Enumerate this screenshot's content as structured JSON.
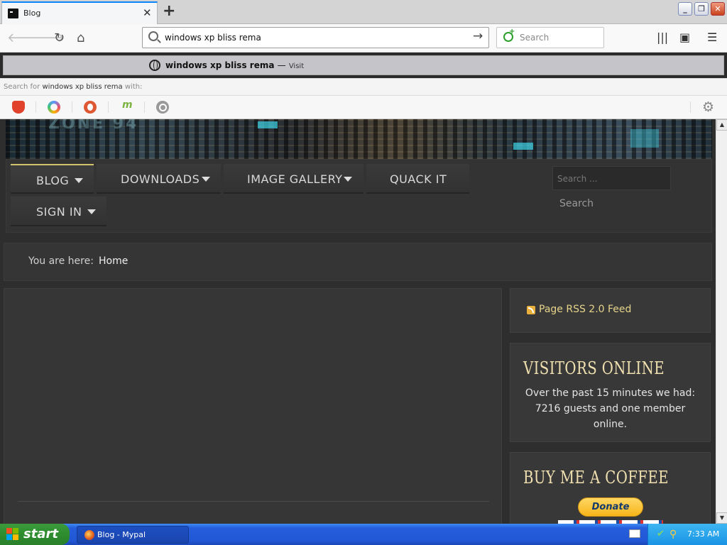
{
  "browser": {
    "tab": {
      "title": "Blog"
    },
    "url_value": "windows xp bliss rema",
    "search_placeholder": "Search",
    "suggestion": {
      "text": "windows xp bliss rema",
      "dash": "—",
      "action": "Visit"
    },
    "search_with": {
      "prefix": "Search for",
      "query": "windows xp bliss rema",
      "suffix": "with:"
    },
    "engines": [
      "brave-icon",
      "qwant-icon",
      "duckduckgo-icon",
      "mojeek-icon",
      "search-icon"
    ]
  },
  "site": {
    "banner_logo": "ZONE 94",
    "menu": {
      "items": [
        {
          "label": "BLOG",
          "has_dropdown": true,
          "active": true
        },
        {
          "label": "DOWNLOADS",
          "has_dropdown": true,
          "active": false
        },
        {
          "label": "IMAGE GALLERY",
          "has_dropdown": true,
          "active": false
        },
        {
          "label": "QUACK IT",
          "has_dropdown": false,
          "active": false
        },
        {
          "label": "SIGN IN",
          "has_dropdown": true,
          "active": false
        }
      ]
    },
    "search": {
      "placeholder": "Search ...",
      "button": "Search"
    },
    "breadcrumb": {
      "prefix": "You are here:",
      "current": "Home"
    },
    "sidebar": {
      "rss": {
        "label": "Page RSS 2.0 Feed"
      },
      "visitors": {
        "title": "VISITORS ONLINE",
        "text": "Over the past 15 minutes we had: 7216 guests and one member online."
      },
      "coffee": {
        "title": "BUY ME A COFFEE",
        "donate_label": "Donate"
      }
    }
  },
  "taskbar": {
    "start_label": "start",
    "task_label": "Blog - Mypal",
    "clock": "7:33 AM"
  },
  "colors": {
    "accent_gold": "#d4c26a",
    "taskbar_blue": "#245edc",
    "start_green": "#2f8f2f",
    "page_bg": "#2e2e2e"
  }
}
